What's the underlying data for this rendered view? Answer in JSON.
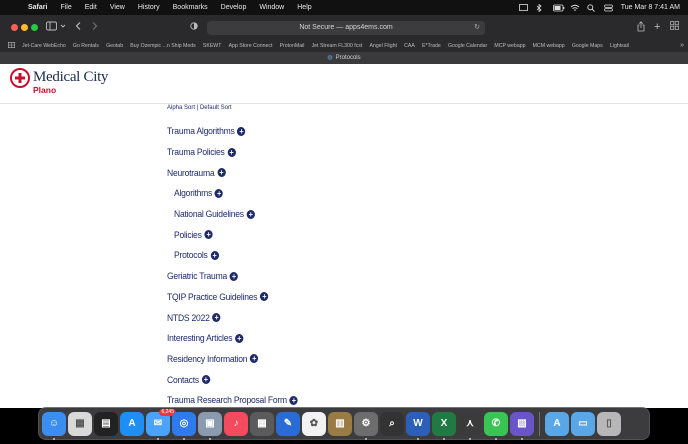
{
  "menubar": {
    "app_name": "Safari",
    "menus": [
      "File",
      "Edit",
      "View",
      "History",
      "Bookmarks",
      "Develop",
      "Window",
      "Help"
    ],
    "datetime": "Tue Mar 8  7:41 AM"
  },
  "browser": {
    "url_text": "Not Secure — apps4ems.com",
    "favorites": [
      "Jet-Care WebEcho",
      "Go Rentals",
      "Geotab",
      "Buy Ozempic ...n Ship Meds",
      "SKEWT",
      "App Store Connect",
      "ProtonMail",
      "Jet Stream FL300 fcst",
      "Angel Flight",
      "CAA",
      "E*Trade",
      "Google Calendar",
      "MCP webapp",
      "MCM webapp",
      "Google Maps",
      "Lightsail"
    ],
    "tab_title": "Protocols"
  },
  "site": {
    "logo_name": "Medical City",
    "logo_sub": "Plano",
    "brand_color": "#c8102e",
    "link_color": "#1f2a6b"
  },
  "sort": {
    "alpha_label": "Alpha Sort",
    "separator": " | ",
    "default_label": "Default Sort"
  },
  "nav": [
    {
      "label": "Trauma Algorithms",
      "sub": false
    },
    {
      "label": "Trauma Policies",
      "sub": false
    },
    {
      "label": "Neurotrauma",
      "sub": false
    },
    {
      "label": "Algorithms",
      "sub": true
    },
    {
      "label": "National Guidelines",
      "sub": true
    },
    {
      "label": "Policies",
      "sub": true
    },
    {
      "label": "Protocols",
      "sub": true
    },
    {
      "label": "Geriatric Trauma",
      "sub": false
    },
    {
      "label": "TQIP Practice Guidelines",
      "sub": false
    },
    {
      "label": "NTDS 2022",
      "sub": false
    },
    {
      "label": "Interesting Articles",
      "sub": false
    },
    {
      "label": "Residency Information",
      "sub": false
    },
    {
      "label": "Contacts",
      "sub": false
    },
    {
      "label": "Trauma Research Proposal Form",
      "sub": false
    }
  ],
  "dock": {
    "mail_badge": "6,245",
    "apps": [
      {
        "name": "finder-app",
        "color": "#3b8df0",
        "glyph": "☺"
      },
      {
        "name": "launchpad-app",
        "color": "#d9d9d9",
        "glyph": "▦"
      },
      {
        "name": "mission-control-app",
        "color": "#222222",
        "glyph": "▤"
      },
      {
        "name": "app-store-app",
        "color": "#1e8ff5",
        "glyph": "A"
      },
      {
        "name": "mail-app",
        "color": "#4aa3ff",
        "glyph": "✉"
      },
      {
        "name": "safari-app",
        "color": "#2e7bf0",
        "glyph": "◎"
      },
      {
        "name": "preview-app",
        "color": "#8a9bb0",
        "glyph": "▣"
      },
      {
        "name": "music-app",
        "color": "#f44a5e",
        "glyph": "♪"
      },
      {
        "name": "calculator-app",
        "color": "#5b5b5b",
        "glyph": "▦"
      },
      {
        "name": "xcode-app",
        "color": "#2a6cd6",
        "glyph": "✎"
      },
      {
        "name": "photos-app",
        "color": "#f2f2f2",
        "glyph": "✿"
      },
      {
        "name": "notes-app",
        "color": "#9a7a45",
        "glyph": "▥"
      },
      {
        "name": "system-settings-app",
        "color": "#6d6d6d",
        "glyph": "⚙"
      },
      {
        "name": "terminal-app",
        "color": "#333333",
        "glyph": "⌕"
      },
      {
        "name": "word-app",
        "color": "#2b5fb8",
        "glyph": "W"
      },
      {
        "name": "excel-app",
        "color": "#1f7a44",
        "glyph": "X"
      },
      {
        "name": "acrobat-app",
        "color": "#3b3b3b",
        "glyph": "⋏"
      },
      {
        "name": "messages-app",
        "color": "#39c553",
        "glyph": "✆"
      },
      {
        "name": "simulator-app",
        "color": "#6a55c8",
        "glyph": "▧"
      }
    ],
    "right_items": [
      {
        "name": "applications-folder",
        "color": "#5aa7e8",
        "glyph": "A"
      },
      {
        "name": "documents-folder",
        "color": "#5aa7e8",
        "glyph": "▭"
      },
      {
        "name": "trash-app",
        "color": "#b7b7b7",
        "glyph": "▯"
      }
    ]
  }
}
